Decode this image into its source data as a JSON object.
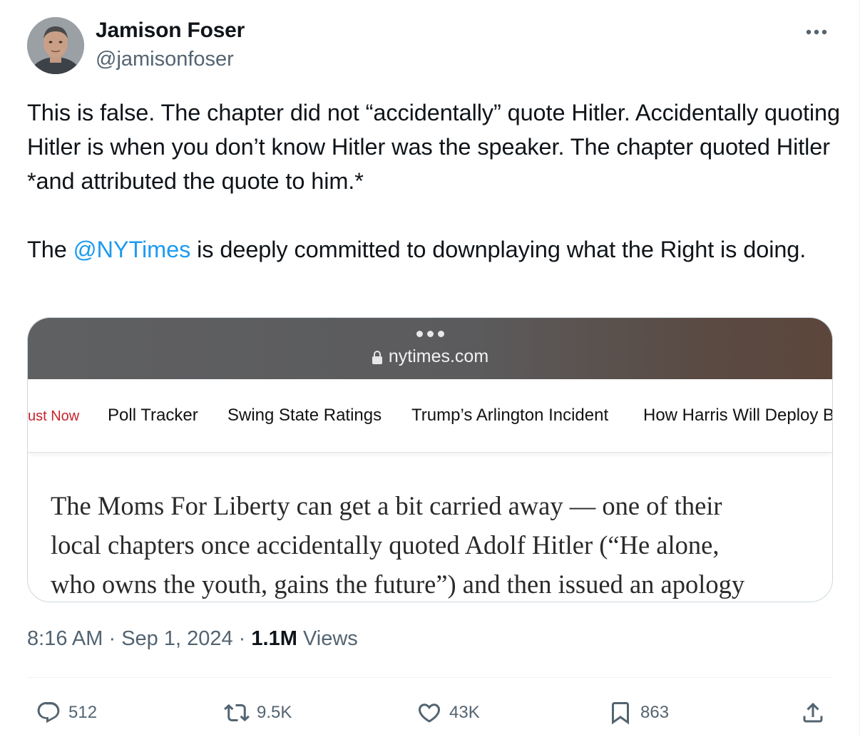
{
  "author": {
    "name": "Jamison Foser",
    "handle": "@jamisonfoser"
  },
  "tweet": {
    "paragraph1": "This is false. The chapter did not “accidentally” quote Hitler. Accidentally quoting Hitler is when you don’t know Hitler was the speaker. The chapter quoted Hitler *and attributed the quote to him.*",
    "paragraph2_before": "The ",
    "mention": "@NYTimes",
    "paragraph2_after": " is deeply committed to downplaying what the Right is doing."
  },
  "media": {
    "url": "nytimes.com",
    "nav": {
      "live": "ust Now",
      "items": [
        "Poll Tracker",
        "Swing State Ratings",
        "Trump’s Arlington Incident",
        "How Harris Will Deploy B"
      ]
    },
    "article_lines": [
      "The Moms For Liberty can get a bit carried away — one of their",
      "local chapters once accidentally quoted Adolf Hitler (“He alone,",
      "who owns the youth, gains the future”) and then issued an apology"
    ]
  },
  "meta": {
    "time": "8:16 AM",
    "separator": " · ",
    "date": "Sep 1, 2024",
    "views_count": "1.1M",
    "views_label": "Views"
  },
  "actions": {
    "replies": "512",
    "reposts": "9.5K",
    "likes": "43K",
    "bookmarks": "863"
  },
  "icons": [
    "more-icon",
    "lock-icon",
    "reply-icon",
    "repost-icon",
    "like-icon",
    "bookmark-icon",
    "share-icon"
  ],
  "colors": {
    "text": "#0f1419",
    "secondary": "#536471",
    "link": "#1d9bf0",
    "nyt_live": "#c6232d"
  }
}
